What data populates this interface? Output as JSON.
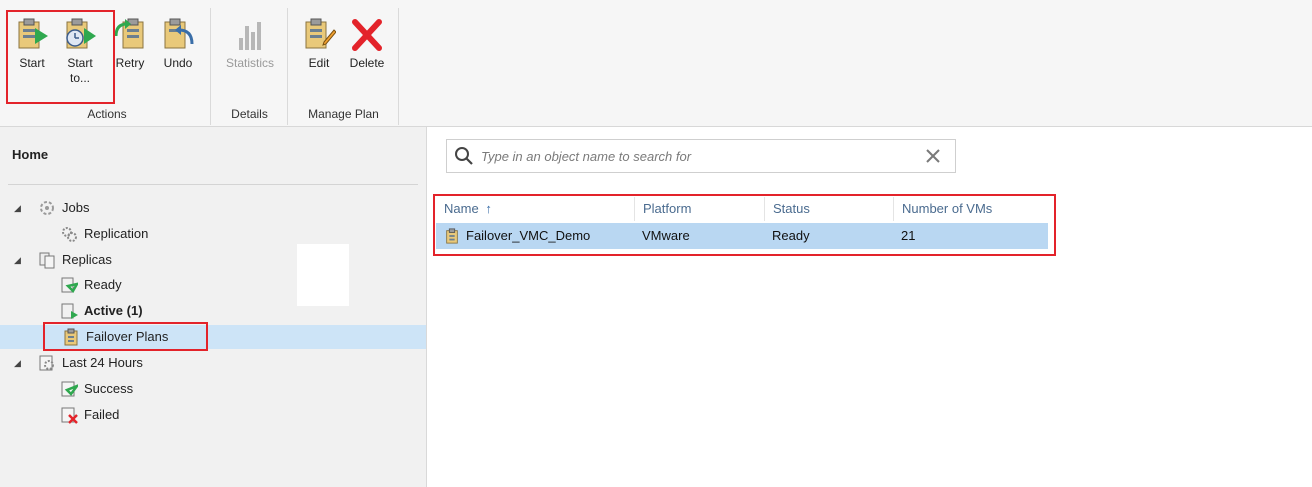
{
  "ribbon": {
    "groups": {
      "actions": "Actions",
      "details": "Details",
      "manage_plan": "Manage Plan"
    },
    "buttons": {
      "start": "Start",
      "start_to_line1": "Start",
      "start_to_line2": "to...",
      "retry": "Retry",
      "undo": "Undo",
      "statistics": "Statistics",
      "edit": "Edit",
      "delete": "Delete"
    }
  },
  "sidebar": {
    "title": "Home",
    "items": [
      {
        "label": "Jobs",
        "icon": "jobs-icon"
      },
      {
        "label": "Replication",
        "icon": "replication-icon"
      },
      {
        "label": "Replicas",
        "icon": "replicas-icon"
      },
      {
        "label": "Ready",
        "icon": "ready-icon"
      },
      {
        "label": "Active (1)",
        "icon": "active-icon"
      },
      {
        "label": "Failover Plans",
        "icon": "failover-plans-icon"
      },
      {
        "label": "Last 24 Hours",
        "icon": "last-24-hours-icon"
      },
      {
        "label": "Success",
        "icon": "success-icon"
      },
      {
        "label": "Failed",
        "icon": "failed-icon"
      }
    ]
  },
  "search": {
    "placeholder": "Type in an object name to search for",
    "value": ""
  },
  "grid": {
    "columns": [
      "Name",
      "Platform",
      "Status",
      "Number of VMs"
    ],
    "sort_indicator": "↑",
    "rows": [
      {
        "name": "Failover_VMC_Demo",
        "platform": "VMware",
        "status": "Ready",
        "vms": "21"
      }
    ]
  },
  "colors": {
    "highlight_box": "#e3232a",
    "selected_row": "#b9d7f2",
    "selected_tree": "#cde4f7",
    "start_arrow": "#2fa84f",
    "delete_x": "#e3232a"
  }
}
